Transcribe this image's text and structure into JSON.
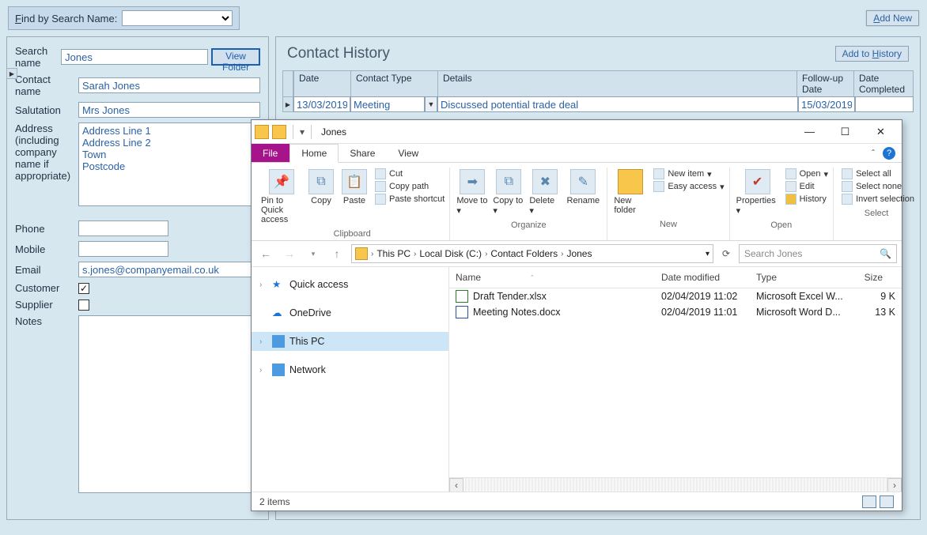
{
  "topbar": {
    "find_label_pre": "F",
    "find_label": "ind by Search Name:",
    "addnew_pre": "A",
    "addnew": "dd New"
  },
  "leftform": {
    "search_name_label": "Search name",
    "search_name": "Jones",
    "view_folder": "View Folder",
    "contact_name_label": "Contact name",
    "contact_name": "Sarah Jones",
    "salutation_label": "Salutation",
    "salutation": "Mrs Jones",
    "address_label": "Address (including company name if appropriate)",
    "address": "Address Line 1\nAddress Line 2\nTown\nPostcode",
    "phone_label": "Phone",
    "phone": "",
    "mobile_label": "Mobile",
    "mobile": "",
    "email_label": "Email",
    "email": "s.jones@companyemail.co.uk",
    "customer_label": "Customer",
    "customer_checked": true,
    "supplier_label": "Supplier",
    "supplier_checked": false,
    "notes_label": "Notes"
  },
  "history": {
    "title": "Contact History",
    "add_pre": "H",
    "add": "Add to ",
    "add_post": "istory",
    "cols": {
      "date": "Date",
      "ctype": "Contact Type",
      "details": "Details",
      "fu": "Follow-up Date",
      "dc": "Date Completed"
    },
    "rows": [
      {
        "date": "13/03/2019",
        "ctype": "Meeting",
        "details": "Discussed potential trade deal",
        "fu": "15/03/2019",
        "dc": ""
      }
    ]
  },
  "explorer": {
    "title": "Jones",
    "tabs": {
      "file": "File",
      "home": "Home",
      "share": "Share",
      "view": "View"
    },
    "ribbon": {
      "pin": "Pin to Quick access",
      "copy": "Copy",
      "paste": "Paste",
      "cut": "Cut",
      "copypath": "Copy path",
      "pasteshort": "Paste shortcut",
      "moveto": "Move to",
      "copyto": "Copy to",
      "delete": "Delete",
      "rename": "Rename",
      "newfolder": "New folder",
      "newitem": "New item",
      "easyaccess": "Easy access",
      "properties": "Properties",
      "open": "Open",
      "edit": "Edit",
      "historyact": "History",
      "selectall": "Select all",
      "selectnone": "Select none",
      "invert": "Invert selection",
      "grp_clipboard": "Clipboard",
      "grp_organize": "Organize",
      "grp_new": "New",
      "grp_open": "Open",
      "grp_select": "Select"
    },
    "breadcrumb": [
      "This PC",
      "Local Disk (C:)",
      "Contact Folders",
      "Jones"
    ],
    "search_placeholder": "Search Jones",
    "navpane": [
      {
        "label": "Quick access",
        "icon": "star"
      },
      {
        "label": "OneDrive",
        "icon": "cloud"
      },
      {
        "label": "This PC",
        "icon": "pc",
        "selected": true
      },
      {
        "label": "Network",
        "icon": "net"
      }
    ],
    "cols": {
      "name": "Name",
      "date": "Date modified",
      "type": "Type",
      "size": "Size"
    },
    "files": [
      {
        "name": "Draft Tender.xlsx",
        "date": "02/04/2019 11:02",
        "type": "Microsoft Excel W...",
        "size": "9 K",
        "kind": "xls"
      },
      {
        "name": "Meeting Notes.docx",
        "date": "02/04/2019 11:01",
        "type": "Microsoft Word D...",
        "size": "13 K",
        "kind": "doc"
      }
    ],
    "status": "2 items"
  }
}
